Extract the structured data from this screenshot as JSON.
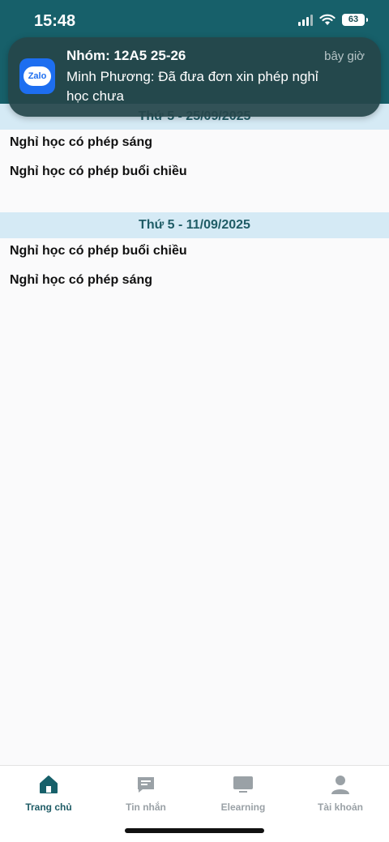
{
  "status_bar": {
    "time": "15:48",
    "battery": "63"
  },
  "notification": {
    "app_icon_label": "Zalo",
    "title": "Nhóm: 12A5 25-26",
    "time": "bây giờ",
    "body": "Minh Phương: Đã đưa đơn xin phép nghỉ học chưa"
  },
  "sections": [
    {
      "date": "Thứ 5 - 25/09/2025",
      "items": [
        "Nghỉ học có phép sáng",
        "Nghỉ học có phép buổi chiều"
      ]
    },
    {
      "date": "Thứ 5 - 11/09/2025",
      "items": [
        "Nghỉ học có phép buổi chiều",
        "Nghỉ học có phép sáng"
      ]
    }
  ],
  "tabbar": {
    "tabs": [
      {
        "label": "Trang chủ",
        "icon": "home-icon",
        "active": true
      },
      {
        "label": "Tin nhắn",
        "icon": "message-icon",
        "active": false
      },
      {
        "label": "Elearning",
        "icon": "monitor-icon",
        "active": false
      },
      {
        "label": "Tài khoản",
        "icon": "user-icon",
        "active": false
      }
    ]
  },
  "colors": {
    "accent": "#17606a",
    "section_bg": "#d5eaf5",
    "inactive": "#9aa1a6"
  }
}
